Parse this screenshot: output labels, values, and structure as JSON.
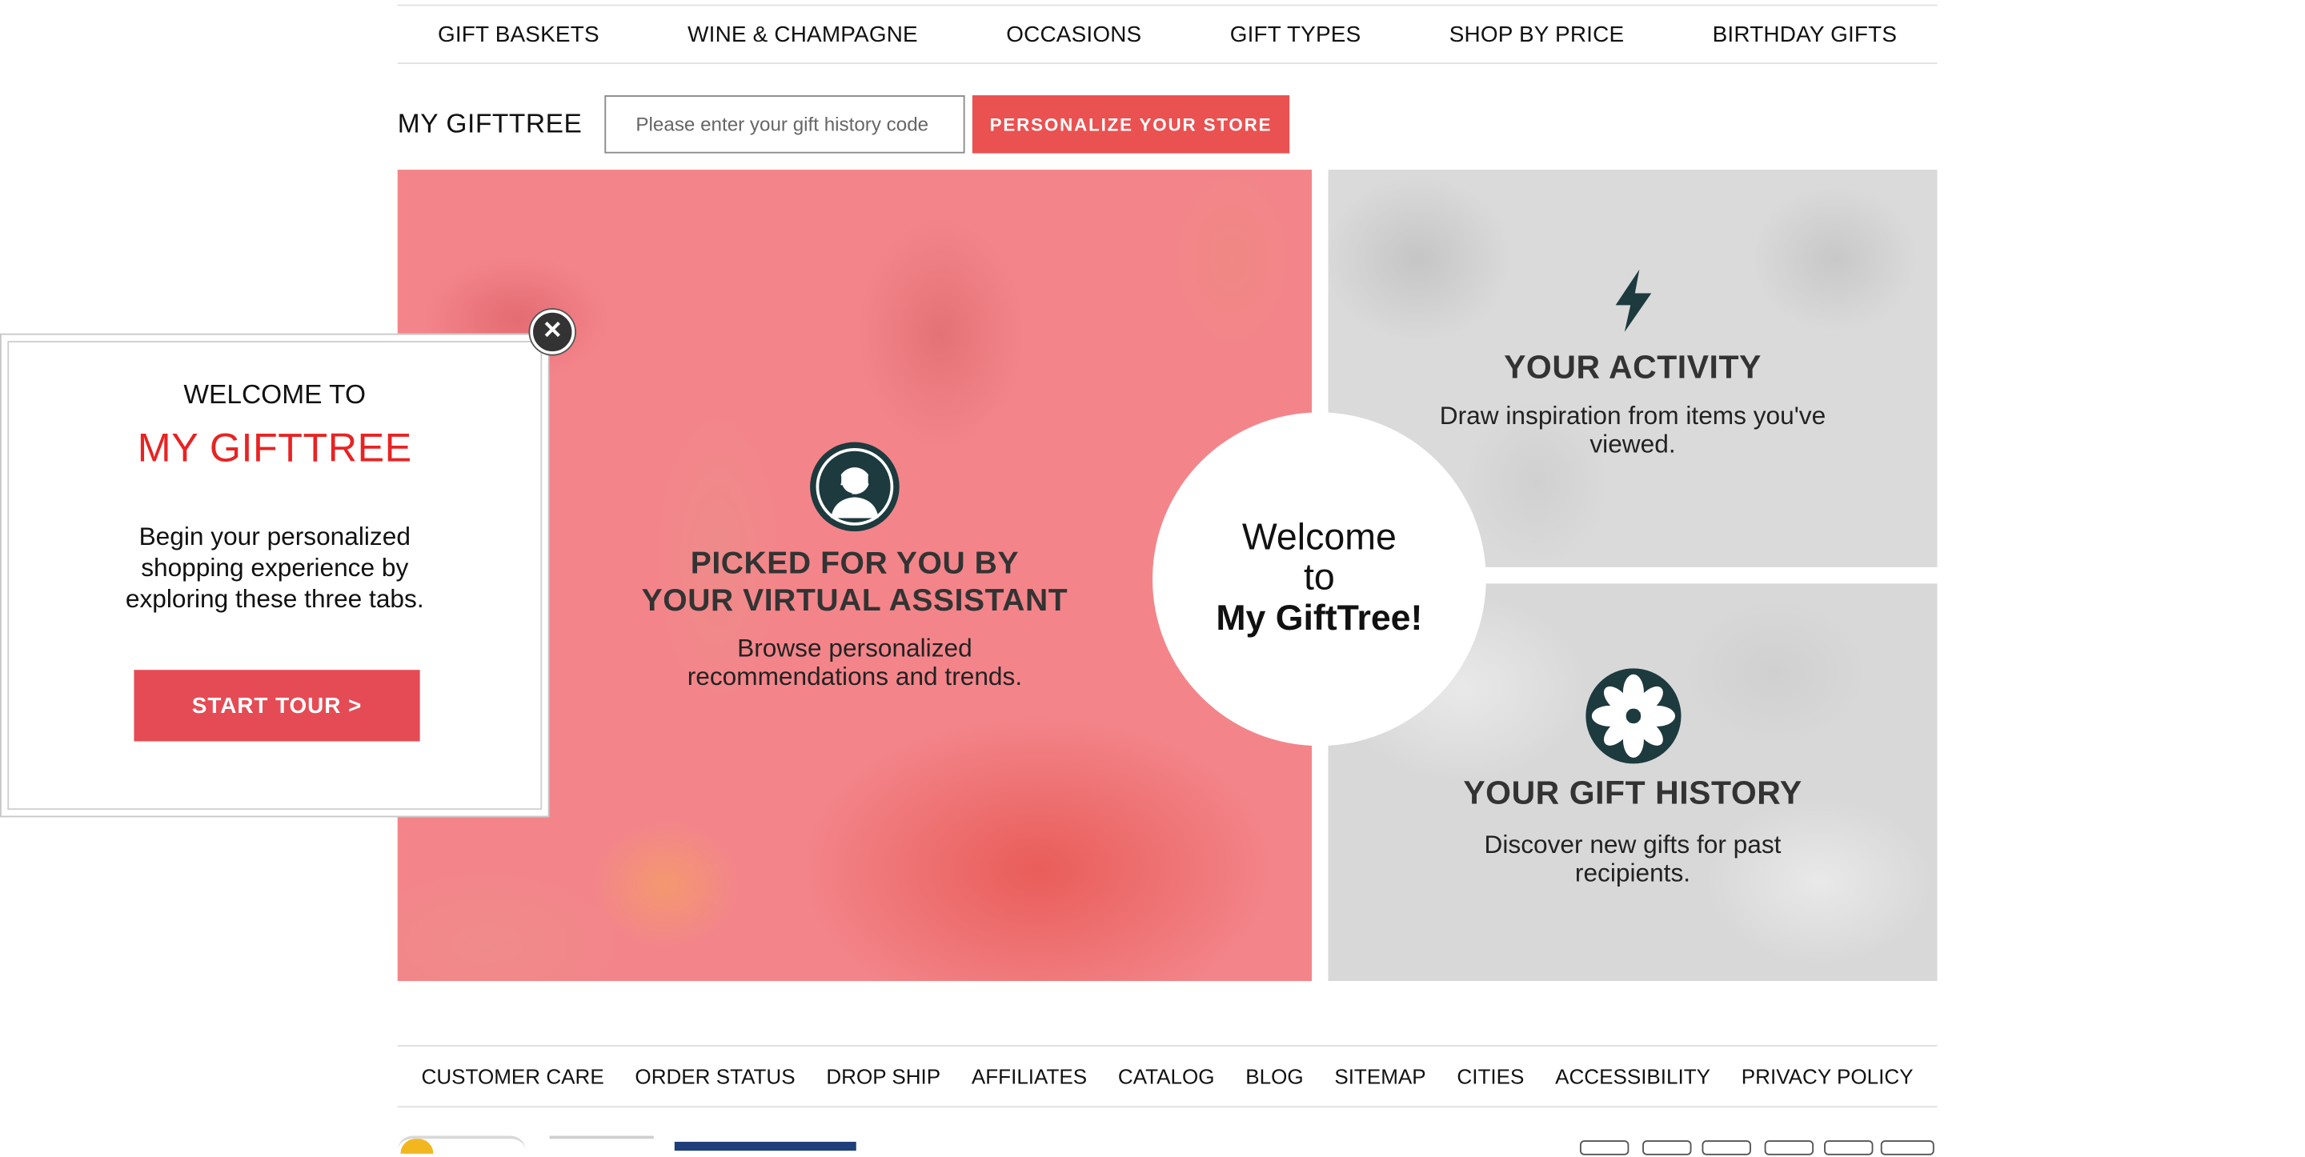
{
  "top_nav": {
    "items": [
      "GIFT BASKETS",
      "WINE & CHAMPAGNE",
      "OCCASIONS",
      "GIFT TYPES",
      "SHOP BY PRICE",
      "BIRTHDAY GIFTS"
    ]
  },
  "my_gifttree": {
    "label": "MY GIFTTREE",
    "input_placeholder": "Please enter your gift history code",
    "input_value": "",
    "button_label": "PERSONALIZE YOUR STORE"
  },
  "panels": {
    "assistant": {
      "title_line1": "PICKED FOR YOU BY",
      "title_line2": "YOUR VIRTUAL ASSISTANT",
      "desc_line1": "Browse personalized",
      "desc_line2": "recommendations and trends.",
      "icon": "virtual-assistant-icon"
    },
    "activity": {
      "title": "YOUR ACTIVITY",
      "desc": "Draw inspiration from items you've viewed.",
      "icon": "lightning-bolt-icon"
    },
    "history": {
      "title": "YOUR GIFT HISTORY",
      "desc": "Discover new gifts for past recipients.",
      "icon": "flower-emblem-icon"
    }
  },
  "center_circle": {
    "line1": "Welcome",
    "line2": "to",
    "line3": "My GiftTree!"
  },
  "popup": {
    "pre_title": "WELCOME TO",
    "title": "MY GIFTTREE",
    "body": "Begin your personalized shopping experience by exploring these three tabs.",
    "button_label": "START TOUR >",
    "close_icon": "close-icon"
  },
  "footer_nav": {
    "items": [
      "CUSTOMER CARE",
      "ORDER STATUS",
      "DROP SHIP",
      "AFFILIATES",
      "CATALOG",
      "BLOG",
      "SITEMAP",
      "CITIES",
      "ACCESSIBILITY",
      "PRIVACY POLICY"
    ]
  },
  "colors": {
    "accent_red": "#ea5151",
    "popup_title_red": "#e82323",
    "icon_teal": "#1d3a3e"
  }
}
